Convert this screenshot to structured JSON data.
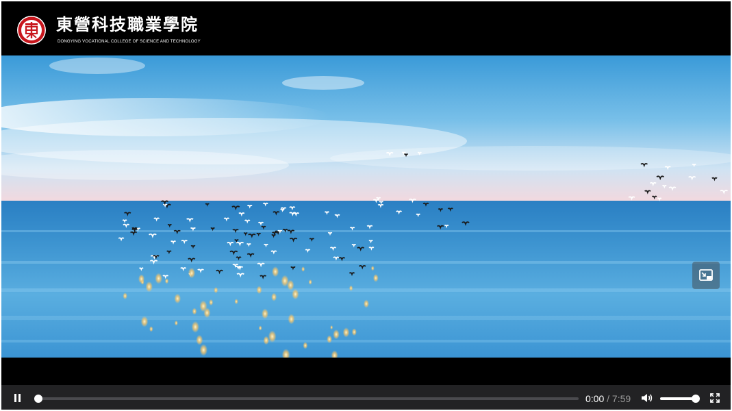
{
  "logo": {
    "icon": "college-emblem",
    "title": "東營科技職業學院",
    "subtitle": "DONGYING VOCATIONAL COLLEGE OF SCIENCE AND TECHNOLOGY"
  },
  "video": {
    "scene": "birds-flying-over-sea"
  },
  "overlay": {
    "pip_icon": "picture-in-picture-icon"
  },
  "controls": {
    "state": "playing",
    "pause_icon": "pause-icon",
    "current_time": "0:00",
    "separator": " / ",
    "total_time": "7:59",
    "progress": 0.0,
    "volume_icon": "volume-icon",
    "volume": 0.95,
    "fullscreen_icon": "fullscreen-icon"
  },
  "colors": {
    "controls_bg": "#222224",
    "emblem_red": "#c8161d",
    "sea_blue": "#2a86c6",
    "sky_blue": "#5fb3e3"
  }
}
